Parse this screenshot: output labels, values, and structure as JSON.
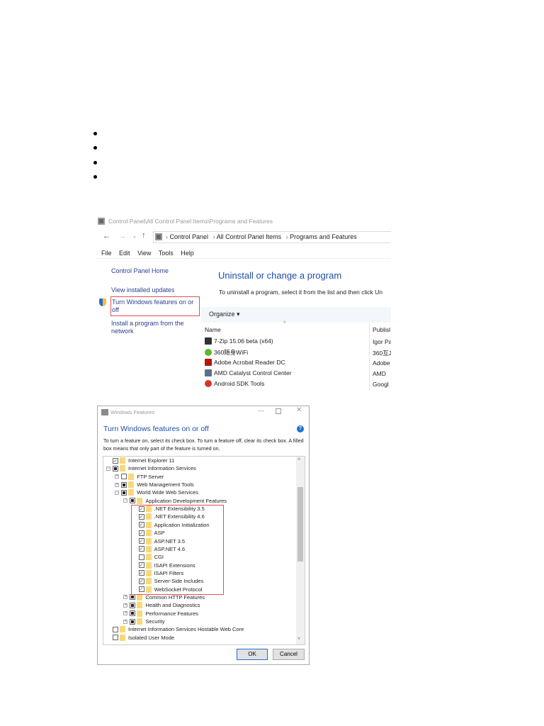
{
  "bullets": [
    "",
    "",
    "",
    ""
  ],
  "programs_window": {
    "title": "Control Panel\\All Control Panel Items\\Programs and Features",
    "breadcrumb": [
      "Control Panel",
      "All Control Panel Items",
      "Programs and Features"
    ],
    "menu": [
      "File",
      "Edit",
      "View",
      "Tools",
      "Help"
    ],
    "sidebar": [
      "Control Panel Home",
      "View installed updates",
      "Turn Windows features on or off",
      "Install a program from the network"
    ],
    "heading": "Uninstall or change a program",
    "description": "To uninstall a program, select it from the list and then click Un",
    "organize": "Organize",
    "columns": [
      "Name",
      "Publisl"
    ],
    "programs": [
      {
        "name": "7-Zip 15.06 beta (x64)",
        "publisher": "Igor Pa",
        "icon": "7zip-icon",
        "color": "#333"
      },
      {
        "name": "360随身WiFi",
        "publisher": "360互J",
        "icon": "wifi-icon",
        "color": "#5cb82e"
      },
      {
        "name": "Adobe Acrobat Reader DC",
        "publisher": "Adobe",
        "icon": "acrobat-icon",
        "color": "#b3160b"
      },
      {
        "name": "AMD Catalyst Control Center",
        "publisher": "AMD",
        "icon": "amd-icon",
        "color": "#5a6f8a"
      },
      {
        "name": "Android SDK Tools",
        "publisher": "Googl",
        "icon": "android-sdk-icon",
        "color": "#d9342b"
      }
    ],
    "highlight_color": "#e05050"
  },
  "features_dialog": {
    "title": "Windows Features",
    "heading": "Turn Windows features on or off",
    "description": "To turn a feature on, select its check box. To turn a feature off, clear its check box. A filled box means that only part of the feature is turned on.",
    "ok": "OK",
    "cancel": "Cancel",
    "items": [
      {
        "label": "Internet Explorer 11",
        "level": 0,
        "state": "checked",
        "expander": ""
      },
      {
        "label": "Internet Information Services",
        "level": 0,
        "state": "partial",
        "expander": "-"
      },
      {
        "label": "FTP Server",
        "level": 1,
        "state": "unchecked",
        "expander": "+"
      },
      {
        "label": "Web Management Tools",
        "level": 1,
        "state": "partial",
        "expander": "+"
      },
      {
        "label": "World Wide Web Services",
        "level": 1,
        "state": "partial",
        "expander": "-"
      },
      {
        "label": "Application Development Features",
        "level": 2,
        "state": "partial",
        "expander": "-"
      },
      {
        "label": ".NET Extensibility 3.5",
        "level": 3,
        "state": "checked",
        "expander": ""
      },
      {
        "label": ".NET Extensibility 4.6",
        "level": 3,
        "state": "checked",
        "expander": ""
      },
      {
        "label": "Application Initialization",
        "level": 3,
        "state": "checked",
        "expander": ""
      },
      {
        "label": "ASP",
        "level": 3,
        "state": "checked",
        "expander": ""
      },
      {
        "label": "ASP.NET 3.5",
        "level": 3,
        "state": "checked",
        "expander": ""
      },
      {
        "label": "ASP.NET 4.6",
        "level": 3,
        "state": "checked",
        "expander": ""
      },
      {
        "label": "CGI",
        "level": 3,
        "state": "unchecked",
        "expander": ""
      },
      {
        "label": "ISAPI Extensions",
        "level": 3,
        "state": "checked",
        "expander": ""
      },
      {
        "label": "ISAPI Filters",
        "level": 3,
        "state": "checked",
        "expander": ""
      },
      {
        "label": "Server-Side Includes",
        "level": 3,
        "state": "checked",
        "expander": ""
      },
      {
        "label": "WebSocket Protocol",
        "level": 3,
        "state": "checked",
        "expander": ""
      },
      {
        "label": "Common HTTP Features",
        "level": 2,
        "state": "partial",
        "expander": "+"
      },
      {
        "label": "Health and Diagnostics",
        "level": 2,
        "state": "partial",
        "expander": "+"
      },
      {
        "label": "Performance Features",
        "level": 2,
        "state": "partial",
        "expander": "+"
      },
      {
        "label": "Security",
        "level": 2,
        "state": "partial",
        "expander": "+"
      },
      {
        "label": "Internet Information Services Hostable Web Core",
        "level": 0,
        "state": "unchecked",
        "expander": ""
      },
      {
        "label": "Isolated User Mode",
        "level": 0,
        "state": "unchecked",
        "expander": ""
      }
    ]
  }
}
